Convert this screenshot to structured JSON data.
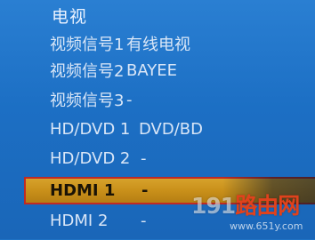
{
  "menu": {
    "title": "电视",
    "items": [
      {
        "label": "视频信号1",
        "value": "有线电视"
      },
      {
        "label": "视频信号2",
        "value": "BAYEE"
      },
      {
        "label": "视频信号3",
        "value": "-"
      },
      {
        "label": "HD/DVD 1",
        "value": "DVD/BD"
      },
      {
        "label": "HD/DVD 2",
        "value": "-"
      },
      {
        "label": "HDMI 1",
        "value": "-",
        "selected": true
      },
      {
        "label": "HDMI 2",
        "value": "-"
      }
    ]
  },
  "watermark": {
    "text_num": "191",
    "text_accent": "路由网",
    "url": "www.651y.com"
  },
  "colors": {
    "background": "#1f72c4",
    "selected_fill": "#c9901a",
    "selected_border": "#c02a23",
    "text": "#d9e6f7"
  }
}
